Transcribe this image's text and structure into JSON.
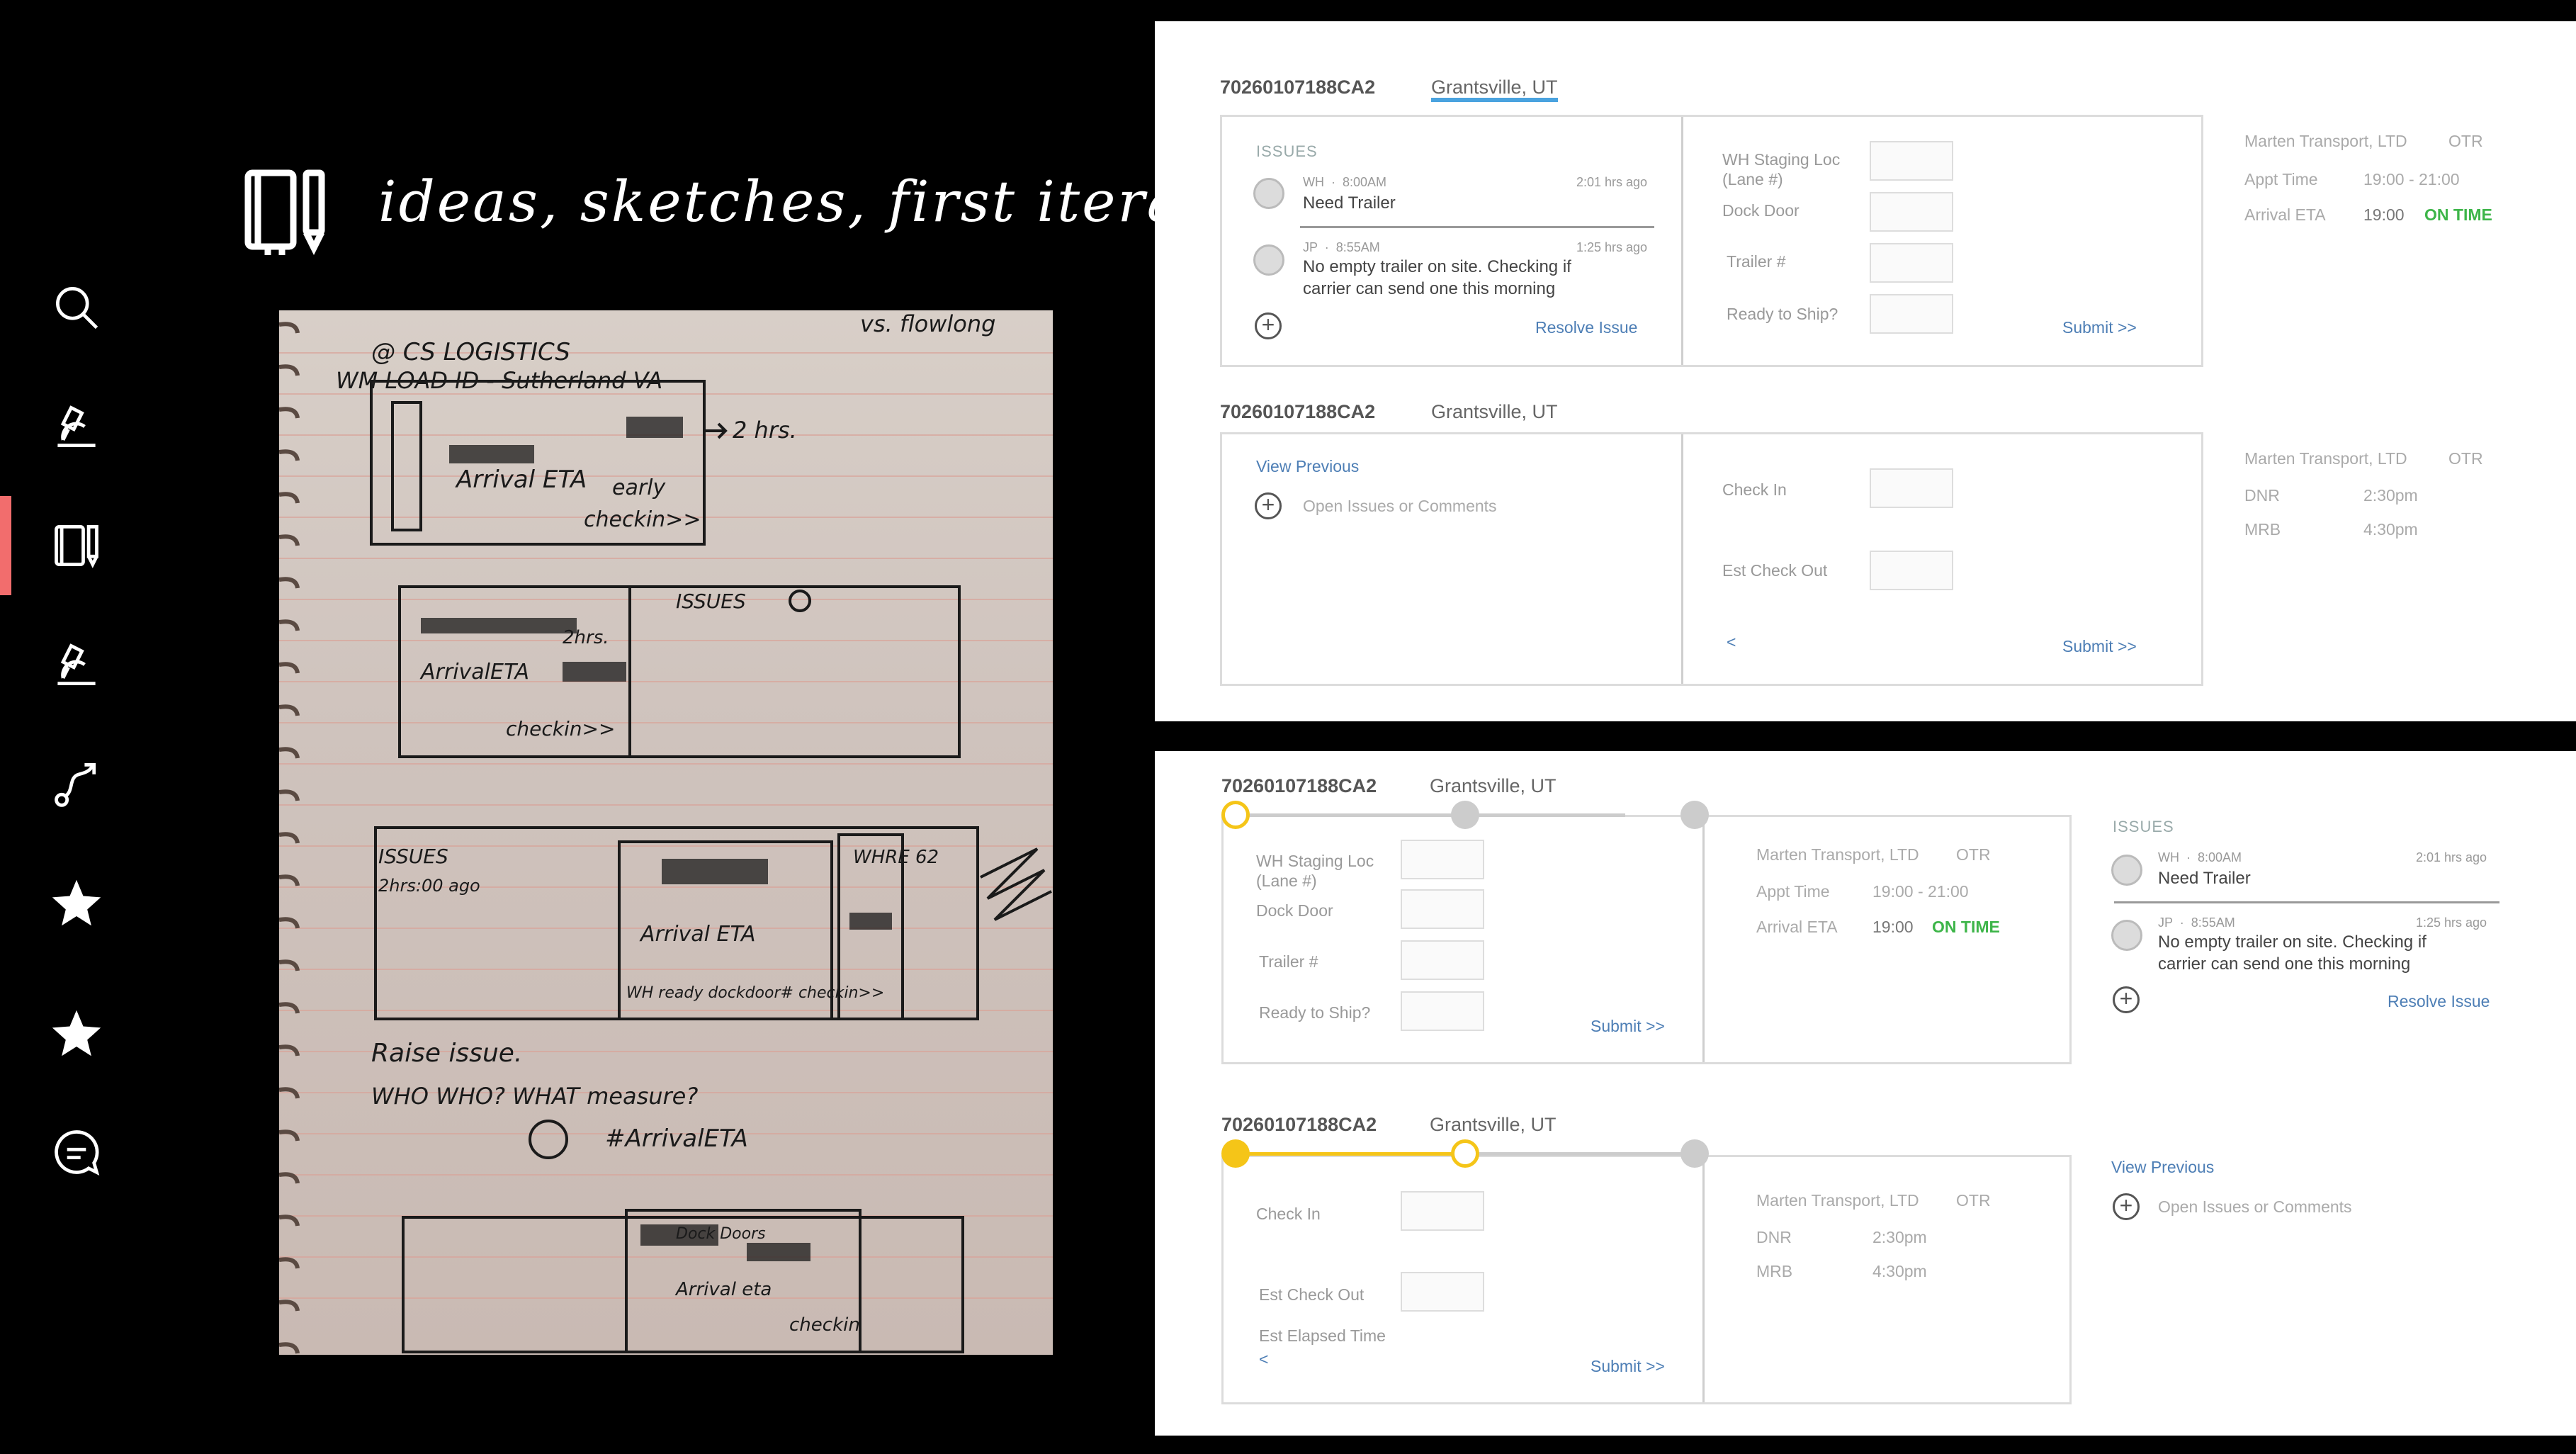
{
  "sidebar": {
    "icons": [
      "search-icon",
      "microscope-icon",
      "notebook-pen-icon",
      "microscope-icon",
      "route-icon",
      "star-icon",
      "star-icon",
      "chat-icon"
    ],
    "active_index": 2,
    "accent": "#f26d6d"
  },
  "heading": {
    "title": "ideas, sketches, first iterations"
  },
  "notebook": {
    "texts": [
      "vs. flowlong",
      "@ CS LOGISTICS",
      "WM LOAD ID - Sutherland VA",
      "2 hrs.",
      "Arrival ETA",
      "early",
      "checkin>>",
      "ISSUES",
      "2hrs.",
      "ArrivalETA",
      "checkin>>",
      "ISSUES",
      "2hrs:00 ago",
      "WHRE 62",
      "Arrival ETA",
      "WH ready dockdoor# checkin>>",
      "Raise issue.",
      "WHO WHO? WHAT measure?",
      "#ArrivalETA",
      "Dock Doors",
      "Arrival eta",
      "checkin"
    ]
  },
  "panel_a": {
    "card1": {
      "ref": "70260107188CA2",
      "location": "Grantsville, UT",
      "issues_title": "ISSUES",
      "issue1": {
        "who": "WH",
        "time": "8:00AM",
        "ago": "2:01 hrs ago",
        "text": "Need Trailer"
      },
      "issue2": {
        "who": "JP",
        "time": "8:55AM",
        "ago": "1:25 hrs ago",
        "text": "No empty trailer on site.  Checking if carrier can send one this morning"
      },
      "resolve": "Resolve Issue",
      "fields": [
        "WH Staging Loc (Lane #)",
        "Dock Door",
        "Trailer #",
        "Ready to Ship?"
      ],
      "submit": "Submit >>",
      "info": {
        "carrier": "Marten Transport, LTD",
        "mode": "OTR",
        "appt_label": "Appt Time",
        "appt": "19:00 - 21:00",
        "eta_label": "Arrival ETA",
        "eta": "19:00",
        "status": "ON TIME"
      }
    },
    "card2": {
      "ref": "70260107188CA2",
      "location": "Grantsville, UT",
      "view_previous": "View Previous",
      "open_issues": "Open Issues or Comments",
      "fields": [
        "Check In",
        "Est Check Out"
      ],
      "back": "<",
      "submit": "Submit >>",
      "info": {
        "carrier": "Marten Transport, LTD",
        "mode": "OTR",
        "dnr_label": "DNR",
        "dnr": "2:30pm",
        "mrb_label": "MRB",
        "mrb": "4:30pm"
      }
    }
  },
  "panel_b": {
    "card1": {
      "ref": "70260107188CA2",
      "location": "Grantsville, UT",
      "fields": [
        "WH Staging Loc (Lane #)",
        "Dock Door",
        "Trailer #",
        "Ready to Ship?"
      ],
      "submit": "Submit >>",
      "info": {
        "carrier": "Marten Transport, LTD",
        "mode": "OTR",
        "appt_label": "Appt Time",
        "appt": "19:00 - 21:00",
        "eta_label": "Arrival ETA",
        "eta": "19:00",
        "status": "ON TIME"
      },
      "issues_title": "ISSUES",
      "issue1": {
        "who": "WH",
        "time": "8:00AM",
        "ago": "2:01 hrs ago",
        "text": "Need Trailer"
      },
      "issue2": {
        "who": "JP",
        "time": "8:55AM",
        "ago": "1:25 hrs ago",
        "text": "No empty trailer on site.  Checking if carrier can send one this morning"
      },
      "resolve": "Resolve Issue",
      "progress_step": 1
    },
    "card2": {
      "ref": "70260107188CA2",
      "location": "Grantsville, UT",
      "fields": [
        "Check In",
        "Est Check Out",
        "Est Elapsed Time"
      ],
      "back": "<",
      "submit": "Submit >>",
      "info": {
        "carrier": "Marten Transport, LTD",
        "mode": "OTR",
        "dnr_label": "DNR",
        "dnr": "2:30pm",
        "mrb_label": "MRB",
        "mrb": "4:30pm"
      },
      "view_previous": "View Previous",
      "open_issues": "Open Issues or Comments",
      "progress_step": 2
    }
  },
  "colors": {
    "accent_yellow": "#f5c518",
    "link_blue": "#4d7eb5",
    "on_time_green": "#3db549"
  }
}
